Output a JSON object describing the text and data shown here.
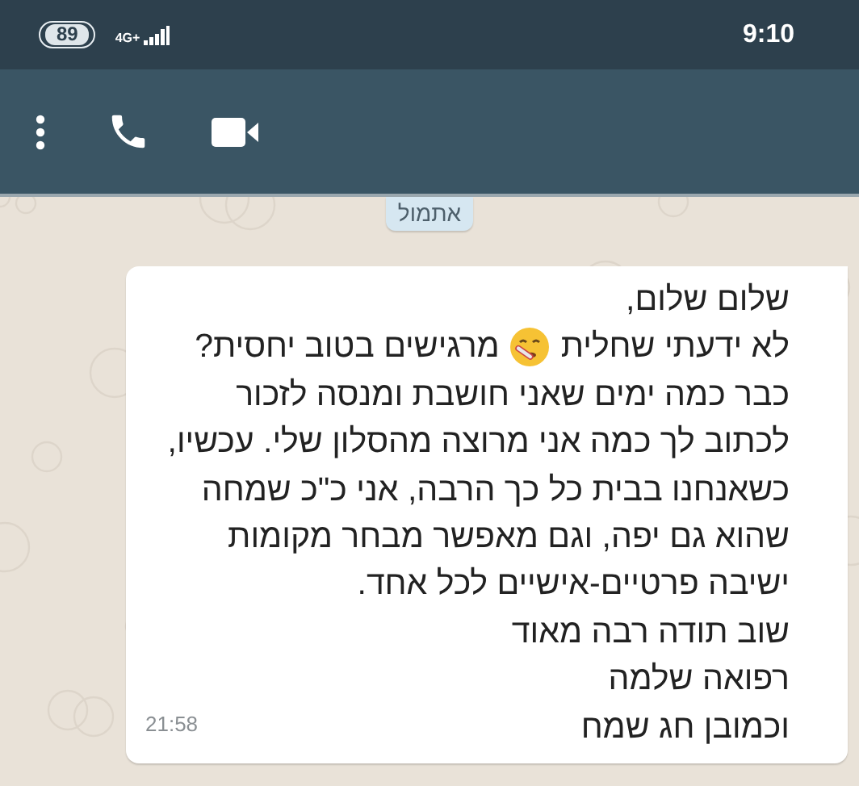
{
  "status_bar": {
    "battery": "89",
    "network": "4G+",
    "time": "9:10"
  },
  "toolbar": {
    "actions": [
      {
        "kind": "menu"
      },
      {
        "kind": "call"
      },
      {
        "kind": "video"
      }
    ]
  },
  "date_chip": "אתמול",
  "message": {
    "lines": [
      {
        "kind": "text",
        "text": "שלום שלום,"
      },
      {
        "kind": "emoji",
        "parts": [
          "לא ידעתי שחלית",
          "מרגישים בטוב יחסית?"
        ]
      },
      {
        "kind": "text",
        "text": "כבר כמה ימים שאני חושבת ומנסה לזכור"
      },
      {
        "kind": "text",
        "text": "לכתוב לך כמה אני מרוצה  מהסלון שלי. עכשיו,"
      },
      {
        "kind": "text",
        "text": "כשאנחנו בבית כל כך הרבה, אני כ\"כ שמחה"
      },
      {
        "kind": "text",
        "text": "שהוא גם יפה, וגם מאפשר מבחר מקומות"
      },
      {
        "kind": "text",
        "text": "ישיבה פרטיים-אישיים לכל אחד."
      },
      {
        "kind": "text",
        "text": "שוב תודה רבה מאוד"
      },
      {
        "kind": "text",
        "text": "רפואה שלמה"
      },
      {
        "kind": "text",
        "text": "וכמובן חג שמח"
      }
    ],
    "time": "21:58"
  }
}
